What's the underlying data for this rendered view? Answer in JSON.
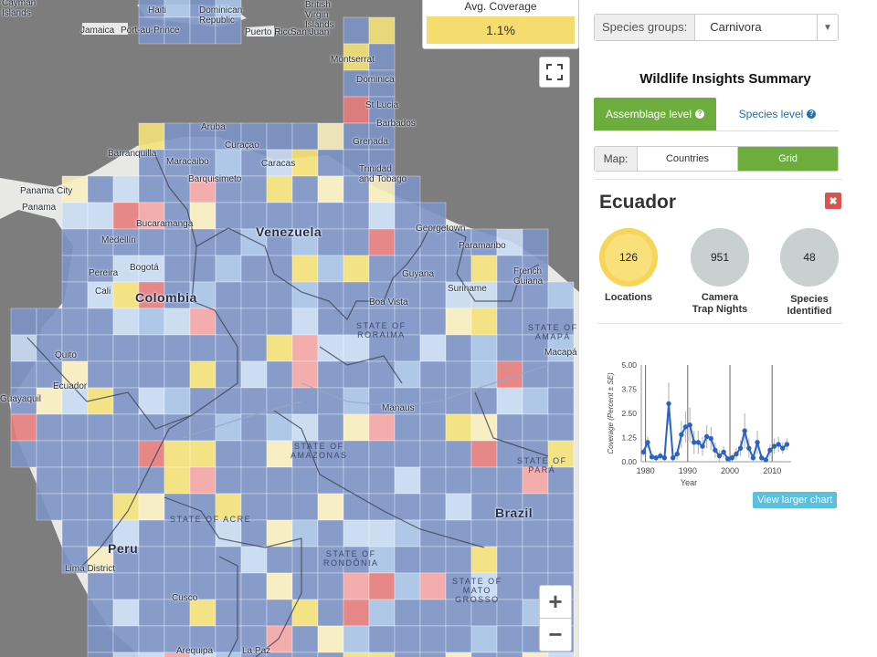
{
  "map": {
    "legend": {
      "title": "Avg. Coverage",
      "value": "1.1%"
    },
    "labels": {
      "cayman": "Cayman\nIslands",
      "haiti": "Haiti",
      "dominican": "Dominican\nRepublic",
      "jamaica": "Jamaica",
      "port_au_prince": "Port-au-Prince",
      "puerto_rico": "Puerto Rico",
      "san_juan": "San Juan",
      "bvi": "British\nVirgin\nIslands",
      "montserrat": "Montserrat",
      "dominica": "Dominica",
      "st_lucia": "St Lucia",
      "barbados": "Barbados",
      "grenada": "Grenada",
      "trinidad": "Trinidad\nand Tobago",
      "aruba": "Aruba",
      "curacao": "Curaçao",
      "barranquilla": "Barranquilla",
      "maracaibo": "Maracaibo",
      "caracas": "Caracas",
      "barquisimeto": "Barquisimeto",
      "panama_city": "Panama City",
      "panama": "Panama",
      "bucaramanga": "Bucaramanga",
      "venezuela": "Venezuela",
      "georgetown": "Georgetown",
      "paramaribo": "Paramaribo",
      "medellin": "Medellín",
      "pereira": "Pereira",
      "bogota": "Bogotá",
      "cali": "Cali",
      "colombia": "Colombia",
      "guyana": "Guyana",
      "suriname": "Suriname",
      "french_guiana": "French\nGuiana",
      "boa_vista": "Boa Vista",
      "roraima": "STATE OF\nRORAIMA",
      "amapa": "STATE OF\nAMAPÁ",
      "macapa": "Macapá",
      "quito": "Quito",
      "ecuador": "Ecuador",
      "guayaquil": "Guayaquil",
      "manaus": "Manaus",
      "amazonas": "STATE OF\nAMAZONAS",
      "para": "STATE OF\nPARÁ",
      "brazil": "Brazil",
      "acre": "STATE OF ACRE",
      "peru": "Peru",
      "lima": "Lima District",
      "rondonia": "STATE OF\nRONDÔNIA",
      "mato_grosso": "STATE OF\nMATO\nGROSSO",
      "cusco": "Cusco",
      "arequipa": "Arequipa",
      "la_paz": "La Paz"
    },
    "fullscreen_icon": "expand-icon",
    "zoom_in": "+",
    "zoom_out": "−"
  },
  "sidebar": {
    "species_label": "Species groups:",
    "species_value": "Carnivora",
    "title": "Wildlife Insights Summary",
    "tabs": [
      {
        "label": "Assemblage level",
        "active": true
      },
      {
        "label": "Species level",
        "active": false
      }
    ],
    "map_label": "Map:",
    "map_options": [
      {
        "label": "Countries",
        "active": false
      },
      {
        "label": "Grid",
        "active": true
      }
    ],
    "country": "Ecuador",
    "stats": [
      {
        "value": "126",
        "label": "Locations",
        "color": "#f9e07a"
      },
      {
        "value": "951",
        "label": "Camera\nTrap Nights",
        "color": "#c9d0d0"
      },
      {
        "value": "48",
        "label": "Species\nIdentified",
        "color": "#c9d0d0"
      }
    ],
    "view_button": "View larger chart"
  },
  "chart_data": {
    "type": "line",
    "xlabel": "Year",
    "ylabel": "Coverage (Percent ± SE)",
    "xticks": [
      "1980",
      "1990",
      "2000",
      "2010"
    ],
    "yticks": [
      "0.00",
      "1.25",
      "2.50",
      "3.75",
      "5.00"
    ],
    "xlim": [
      1979,
      2014.5
    ],
    "ylim": [
      0,
      5
    ],
    "color": "#2a63c6",
    "series": [
      {
        "x": [
          1979.5,
          1980.5,
          1981.5,
          1982.5,
          1983.5,
          1984.5,
          1985.5,
          1986.5,
          1987.5,
          1988.5,
          1989.5,
          1990.5,
          1991.5,
          1992.5,
          1993.5,
          1994.5,
          1995.5,
          1996.5,
          1997.5,
          1998.5,
          1999.5,
          2000.5,
          2001.5,
          2002.5,
          2003.5,
          2004.5,
          2005.5,
          2006.5,
          2007.5,
          2008.5,
          2009.5,
          2010.5,
          2011.5,
          2012.5,
          2013.5
        ],
        "y": [
          0.5,
          1.0,
          0.25,
          0.2,
          0.3,
          0.2,
          3.0,
          0.2,
          0.4,
          1.4,
          1.8,
          1.9,
          1.0,
          1.0,
          0.8,
          1.3,
          1.2,
          0.6,
          0.3,
          0.5,
          0.15,
          0.2,
          0.4,
          0.7,
          1.6,
          0.7,
          0.2,
          1.0,
          0.2,
          0.1,
          0.6,
          0.8,
          0.9,
          0.7,
          0.9
        ],
        "err": [
          0.2,
          0.3,
          0.15,
          0.15,
          0.2,
          0.15,
          1.1,
          0.2,
          0.3,
          0.7,
          0.8,
          0.9,
          0.6,
          0.6,
          0.5,
          0.6,
          0.6,
          0.4,
          0.3,
          0.3,
          0.15,
          0.2,
          0.3,
          0.4,
          0.9,
          0.5,
          0.2,
          0.6,
          0.2,
          0.1,
          0.3,
          0.4,
          0.4,
          0.3,
          0.3
        ]
      }
    ]
  }
}
